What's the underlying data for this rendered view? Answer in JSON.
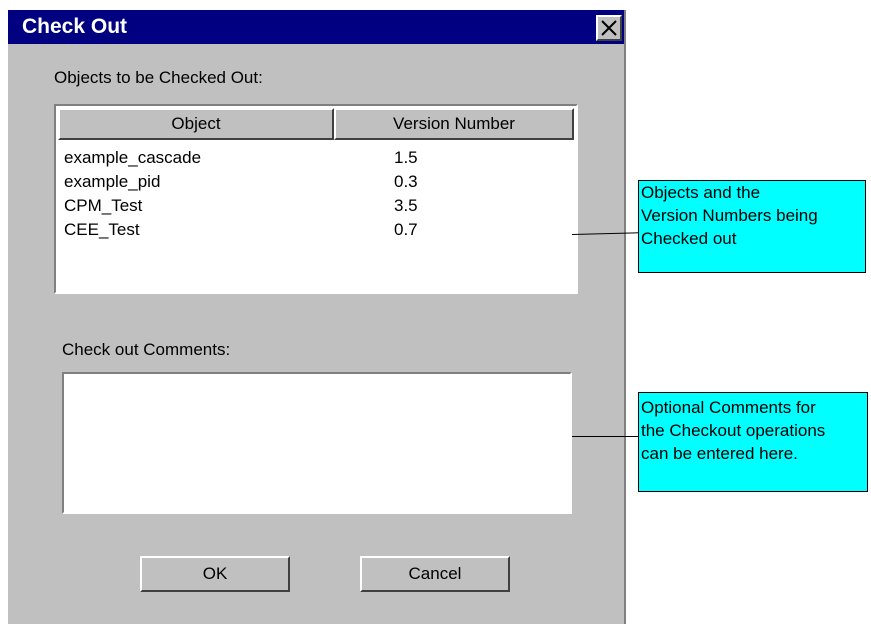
{
  "dialog": {
    "title": "Check Out",
    "close_glyph": "close-icon",
    "objects_label": "Objects to be Checked Out:",
    "columns": [
      "Object",
      "Version Number"
    ],
    "rows": [
      {
        "object": "example_cascade",
        "version": "1.5"
      },
      {
        "object": "example_pid",
        "version": "0.3"
      },
      {
        "object": "CPM_Test",
        "version": "3.5"
      },
      {
        "object": "CEE_Test",
        "version": "0.7"
      }
    ],
    "comments_label": "Check out Comments:",
    "comments_value": "",
    "ok_label": "OK",
    "cancel_label": "Cancel"
  },
  "callouts": {
    "objects_note": [
      "Objects and the",
      "Version Numbers being",
      "Checked out"
    ],
    "comments_note": [
      "Optional Comments for",
      "the Checkout operations",
      "can be entered here."
    ]
  },
  "colors": {
    "titlebar": "#000080",
    "dialog_bg": "#c0c0c0",
    "callout_bg": "#00ffff"
  }
}
